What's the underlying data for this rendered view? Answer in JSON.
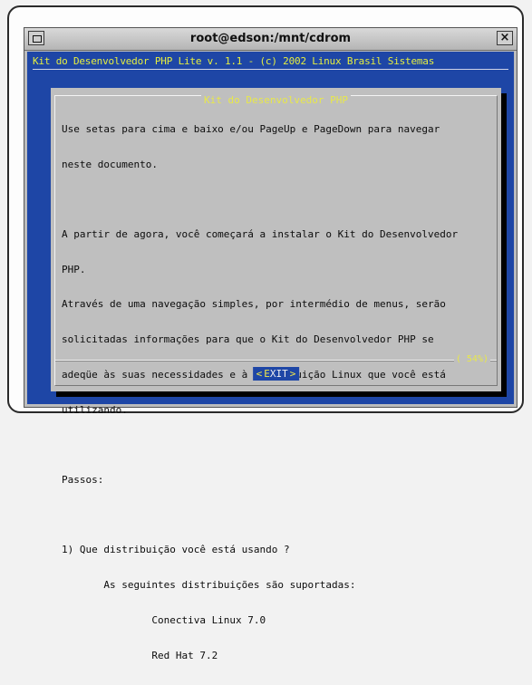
{
  "window": {
    "title": "root@edson:/mnt/cdrom",
    "menu_glyph": "",
    "close_glyph": "×"
  },
  "terminal": {
    "backtitle": "Kit do Desenvolvedor PHP Lite v. 1.1 - (c) 2002 Linux Brasil Sistemas"
  },
  "dialog": {
    "title": "Kit do Desenvolvedor PHP",
    "lines": [
      "Use setas para cima e baixo e/ou PageUp e PageDown para navegar",
      "neste documento.",
      "",
      "A partir de agora, você começará a instalar o Kit do Desenvolvedor",
      "PHP.",
      "Através de uma navegação simples, por intermédio de menus, serão",
      "solicitadas informações para que o Kit do Desenvolvedor PHP se",
      "adeqüe às suas necessidades e à distribuição Linux que você está",
      "utilizando.",
      "",
      "Passos:",
      "",
      "1) Que distribuição você está usando ?",
      "       As seguintes distribuições são suportadas:",
      "               Conectiva Linux 7.0",
      "               Red Hat 7.2"
    ],
    "percent": "( 54%)",
    "exit": {
      "left": "<",
      "first_letter": "E",
      "rest": "XIT",
      "right": ">"
    }
  }
}
